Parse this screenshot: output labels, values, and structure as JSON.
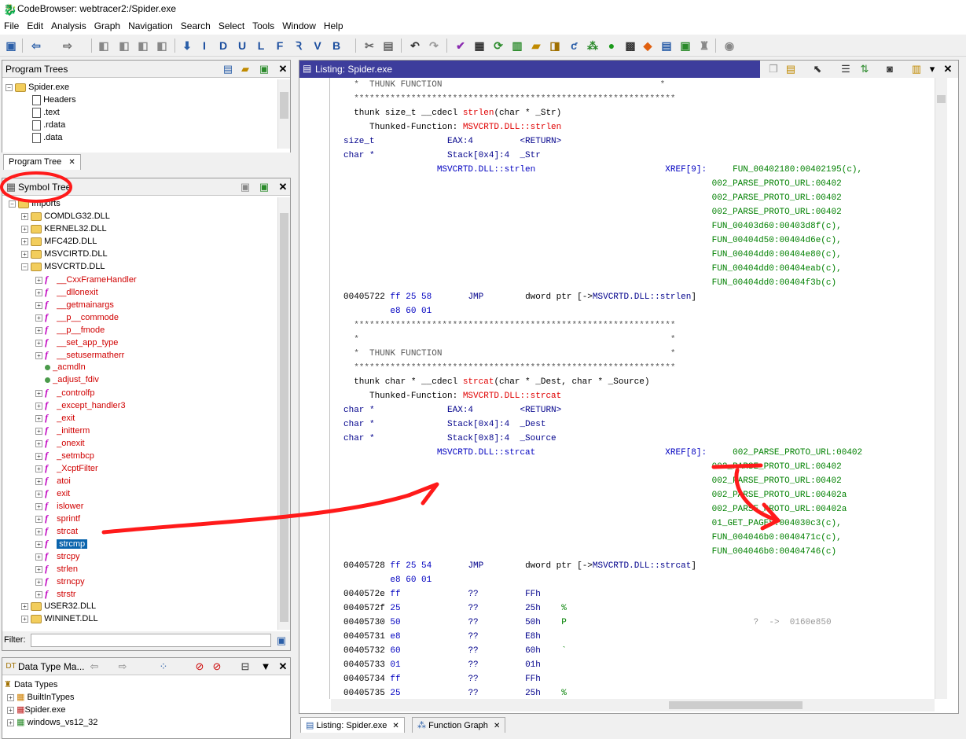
{
  "window": {
    "title": "CodeBrowser: webtracer2:/Spider.exe"
  },
  "menu": [
    "File",
    "Edit",
    "Analysis",
    "Graph",
    "Navigation",
    "Search",
    "Select",
    "Tools",
    "Window",
    "Help"
  ],
  "toolbar_letters": [
    "I",
    "D",
    "U",
    "L",
    "F",
    "V",
    "B"
  ],
  "program_trees": {
    "title": "Program Trees",
    "root": "Spider.exe",
    "items": [
      "Headers",
      ".text",
      ".rdata",
      ".data"
    ],
    "tab": "Program Tree"
  },
  "symbol_tree": {
    "title": "Symbol Tree",
    "root": "Imports",
    "dlls_before": [
      "COMDLG32.DLL",
      "KERNEL32.DLL",
      "MFC42D.DLL",
      "MSVCIRTD.DLL",
      "MSVCRTD.DLL"
    ],
    "functions": [
      "__CxxFrameHandler",
      "__dllonexit",
      "__getmainargs",
      "__p__commode",
      "__p__fmode",
      "__set_app_type",
      "__setusermatherr",
      "_acmdln",
      "_adjust_fdiv",
      "_controlfp",
      "_except_handler3",
      "_exit",
      "_initterm",
      "_onexit",
      "_setmbcp",
      "_XcptFilter",
      "atoi",
      "exit",
      "islower",
      "sprintf",
      "strcat",
      "strcmp",
      "strcpy",
      "strlen",
      "strncpy",
      "strstr"
    ],
    "selected": "strcmp",
    "dlls_after": [
      "USER32.DLL",
      "WININET.DLL"
    ],
    "filter_label": "Filter:"
  },
  "data_types": {
    "title": "Data Type Ma...",
    "root": "Data Types",
    "items": [
      "BuiltInTypes",
      "Spider.exe",
      "windows_vs12_32"
    ]
  },
  "listing": {
    "title": "Listing:  Spider.exe",
    "lines": [
      [
        {
          "t": "  *  THUNK FUNCTION                                          *",
          "c": "grey"
        }
      ],
      [
        {
          "t": "  **************************************************************",
          "c": "grey"
        }
      ],
      [
        {
          "t": "  thunk size_t __cdecl ",
          "c": ""
        },
        {
          "t": "strlen",
          "c": "cred"
        },
        {
          "t": "(char * _Str)",
          "c": ""
        }
      ],
      [
        {
          "t": "     Thunked-Function: ",
          "c": ""
        },
        {
          "t": "MSVCRTD.DLL::strlen",
          "c": "cred"
        }
      ],
      [
        {
          "t": "size_t              ",
          "c": "navy"
        },
        {
          "t": "EAX:4         ",
          "c": "navy"
        },
        {
          "t": "<RETURN>",
          "c": "navy"
        }
      ],
      [
        {
          "t": "char *              ",
          "c": "navy"
        },
        {
          "t": "Stack[0x4]:4  ",
          "c": "navy"
        },
        {
          "t": "_Str",
          "c": "navy"
        }
      ],
      [
        {
          "t": "                  MSVCRTD.DLL::strlen",
          "c": "blue"
        },
        {
          "t": "                         XREF[9]:     ",
          "c": "blue"
        },
        {
          "t": "FUN_00402180:00402195(c),",
          "c": "grn"
        }
      ],
      [
        {
          "t": "                                                                       002_PARSE_PROTO_URL:00402",
          "c": "grn"
        }
      ],
      [
        {
          "t": "                                                                       002_PARSE_PROTO_URL:00402",
          "c": "grn"
        }
      ],
      [
        {
          "t": "                                                                       002_PARSE_PROTO_URL:00402",
          "c": "grn"
        }
      ],
      [
        {
          "t": "                                                                       FUN_00403d60:00403d8f(c),",
          "c": "grn"
        }
      ],
      [
        {
          "t": "                                                                       FUN_00404d50:00404d6e(c),",
          "c": "grn"
        }
      ],
      [
        {
          "t": "                                                                       FUN_00404dd0:00404e80(c),",
          "c": "grn"
        }
      ],
      [
        {
          "t": "                                                                       FUN_00404dd0:00404eab(c),",
          "c": "grn"
        }
      ],
      [
        {
          "t": "                                                                       FUN_00404dd0:00404f3b(c)",
          "c": "grn"
        }
      ],
      [
        {
          "t": "00405722 ",
          "c": ""
        },
        {
          "t": "ff 25 58       ",
          "c": "blue"
        },
        {
          "t": "JMP        ",
          "c": "navy"
        },
        {
          "t": "dword ptr [->",
          "c": ""
        },
        {
          "t": "MSVCRTD.DLL::strlen",
          "c": "navy"
        },
        {
          "t": "]",
          "c": ""
        }
      ],
      [
        {
          "t": "         ",
          "c": ""
        },
        {
          "t": "e8 60 01",
          "c": "blue"
        }
      ],
      [
        {
          "t": "  **************************************************************",
          "c": "grey"
        }
      ],
      [
        {
          "t": "  *                                                            *",
          "c": "grey"
        }
      ],
      [
        {
          "t": "  *  THUNK FUNCTION                                            *",
          "c": "grey"
        }
      ],
      [
        {
          "t": "  **************************************************************",
          "c": "grey"
        }
      ],
      [
        {
          "t": "  thunk char * __cdecl ",
          "c": ""
        },
        {
          "t": "strcat",
          "c": "cred"
        },
        {
          "t": "(char * _Dest, char * _Source)",
          "c": ""
        }
      ],
      [
        {
          "t": "     Thunked-Function: ",
          "c": ""
        },
        {
          "t": "MSVCRTD.DLL::strcat",
          "c": "cred"
        }
      ],
      [
        {
          "t": "char *              ",
          "c": "navy"
        },
        {
          "t": "EAX:4         ",
          "c": "navy"
        },
        {
          "t": "<RETURN>",
          "c": "navy"
        }
      ],
      [
        {
          "t": "char *              ",
          "c": "navy"
        },
        {
          "t": "Stack[0x4]:4  ",
          "c": "navy"
        },
        {
          "t": "_Dest",
          "c": "navy"
        }
      ],
      [
        {
          "t": "char *              ",
          "c": "navy"
        },
        {
          "t": "Stack[0x8]:4  ",
          "c": "navy"
        },
        {
          "t": "_Source",
          "c": "navy"
        }
      ],
      [
        {
          "t": "                  MSVCRTD.DLL::strcat",
          "c": "blue"
        },
        {
          "t": "                         XREF[8]:     ",
          "c": "blue"
        },
        {
          "t": "002_PARSE_PROTO_URL:00402",
          "c": "grn"
        }
      ],
      [
        {
          "t": "                                                                       002_PARSE_PROTO_URL:00402",
          "c": "grn"
        }
      ],
      [
        {
          "t": "                                                                       002_PARSE_PROTO_URL:00402",
          "c": "grn"
        }
      ],
      [
        {
          "t": "                                                                       002_PARSE_PROTO_URL:00402a",
          "c": "grn"
        }
      ],
      [
        {
          "t": "                                                                       002_PARSE_PROTO_URL:00402a",
          "c": "grn"
        }
      ],
      [
        {
          "t": "                                                                       01_GET_PAGES:004030c3(c),",
          "c": "grn"
        }
      ],
      [
        {
          "t": "                                                                       FUN_004046b0:0040471c(c),",
          "c": "grn"
        }
      ],
      [
        {
          "t": "                                                                       FUN_004046b0:00404746(c)",
          "c": "grn"
        }
      ],
      [
        {
          "t": "00405728 ",
          "c": ""
        },
        {
          "t": "ff 25 54       ",
          "c": "blue"
        },
        {
          "t": "JMP        ",
          "c": "navy"
        },
        {
          "t": "dword ptr [->",
          "c": ""
        },
        {
          "t": "MSVCRTD.DLL::strcat",
          "c": "navy"
        },
        {
          "t": "]",
          "c": ""
        }
      ],
      [
        {
          "t": "         ",
          "c": ""
        },
        {
          "t": "e8 60 01",
          "c": "blue"
        }
      ],
      [
        {
          "t": "0040572e ",
          "c": ""
        },
        {
          "t": "ff             ",
          "c": "blue"
        },
        {
          "t": "??         ",
          "c": "navy"
        },
        {
          "t": "FFh",
          "c": "navy"
        }
      ],
      [
        {
          "t": "0040572f ",
          "c": ""
        },
        {
          "t": "25             ",
          "c": "blue"
        },
        {
          "t": "??         ",
          "c": "navy"
        },
        {
          "t": "25h    ",
          "c": "navy"
        },
        {
          "t": "%",
          "c": "grn"
        }
      ],
      [
        {
          "t": "00405730 ",
          "c": ""
        },
        {
          "t": "50             ",
          "c": "blue"
        },
        {
          "t": "??         ",
          "c": "navy"
        },
        {
          "t": "50h    ",
          "c": "navy"
        },
        {
          "t": "P",
          "c": "grn"
        },
        {
          "t": "                                    ?  ->  0160e850",
          "c": "lgrey"
        }
      ],
      [
        {
          "t": "00405731 ",
          "c": ""
        },
        {
          "t": "e8             ",
          "c": "blue"
        },
        {
          "t": "??         ",
          "c": "navy"
        },
        {
          "t": "E8h",
          "c": "navy"
        }
      ],
      [
        {
          "t": "00405732 ",
          "c": ""
        },
        {
          "t": "60             ",
          "c": "blue"
        },
        {
          "t": "??         ",
          "c": "navy"
        },
        {
          "t": "60h    ",
          "c": "navy"
        },
        {
          "t": "`",
          "c": "grn"
        }
      ],
      [
        {
          "t": "00405733 ",
          "c": ""
        },
        {
          "t": "01             ",
          "c": "blue"
        },
        {
          "t": "??         ",
          "c": "navy"
        },
        {
          "t": "01h",
          "c": "navy"
        }
      ],
      [
        {
          "t": "00405734 ",
          "c": ""
        },
        {
          "t": "ff             ",
          "c": "blue"
        },
        {
          "t": "??         ",
          "c": "navy"
        },
        {
          "t": "FFh",
          "c": "navy"
        }
      ],
      [
        {
          "t": "00405735 ",
          "c": ""
        },
        {
          "t": "25             ",
          "c": "blue"
        },
        {
          "t": "??         ",
          "c": "navy"
        },
        {
          "t": "25h    ",
          "c": "navy"
        },
        {
          "t": "%",
          "c": "grn"
        }
      ]
    ]
  },
  "bottom_tabs": [
    "Listing:  Spider.exe",
    "Function Graph"
  ],
  "colors": {
    "annotation": "#ff1a1a",
    "listing_header": "#3d3d9c",
    "selected": "#0a64ad"
  }
}
